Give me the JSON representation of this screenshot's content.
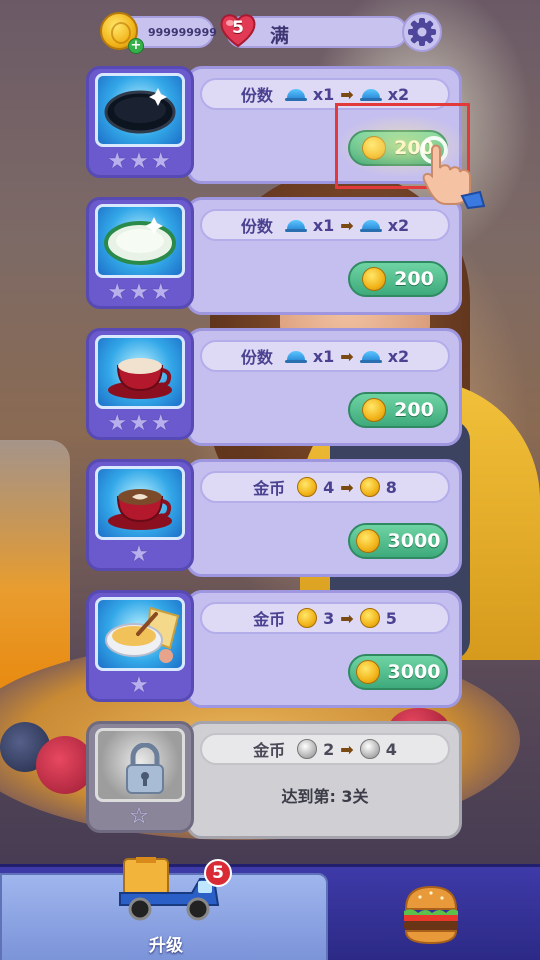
{
  "topbar": {
    "coins": "999999999",
    "lives": "5",
    "lives_status": "满"
  },
  "upgrades": [
    {
      "name": "black-plate",
      "stat_label": "份数",
      "from": "x1",
      "to": "x2",
      "stat_icon": "cloche-icon",
      "price": "200",
      "stars": "★★★",
      "locked": false,
      "highlighted": true
    },
    {
      "name": "white-plate",
      "stat_label": "份数",
      "from": "x1",
      "to": "x2",
      "stat_icon": "cloche-icon",
      "price": "200",
      "stars": "★★★",
      "locked": false
    },
    {
      "name": "red-cup",
      "stat_label": "份数",
      "from": "x1",
      "to": "x2",
      "stat_icon": "cloche-icon",
      "price": "200",
      "stars": "★★★",
      "locked": false
    },
    {
      "name": "latte-cup",
      "stat_label": "金币",
      "from": "4",
      "to": "8",
      "stat_icon": "coin-icon",
      "price": "3000",
      "stars": "★",
      "locked": false
    },
    {
      "name": "custard-bowl",
      "stat_label": "金币",
      "from": "3",
      "to": "5",
      "stat_icon": "coin-icon",
      "price": "3000",
      "stars": "★",
      "locked": false
    },
    {
      "name": "locked-item",
      "stat_label": "金币",
      "from": "2",
      "to": "4",
      "stat_icon": "coin-icon",
      "requirement": "达到第: 3关",
      "stars": "☆",
      "locked": true
    }
  ],
  "bottom_nav": {
    "upgrade_label": "升级",
    "upgrade_badge": "5"
  },
  "colors": {
    "panel": "#c5bff0",
    "buy_button": "#3eaa7c",
    "highlight": "#e23a3a",
    "nav": "#2c2a86"
  }
}
